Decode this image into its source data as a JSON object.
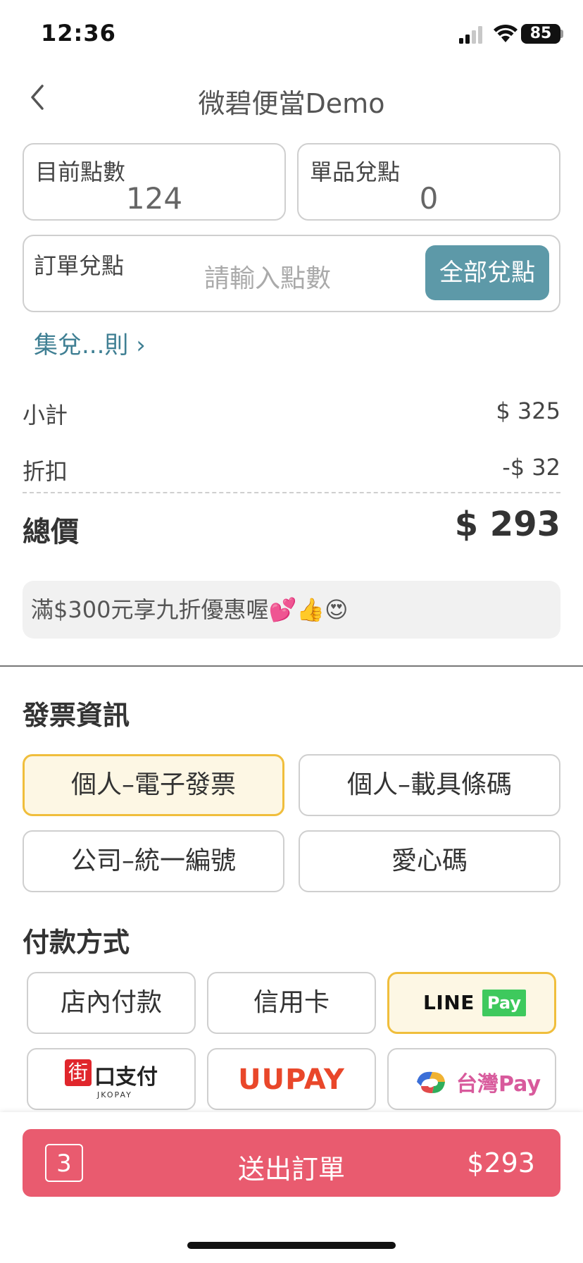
{
  "status_bar": {
    "time": "12:36",
    "battery": "85"
  },
  "nav": {
    "title": "微碧便當Demo"
  },
  "points": {
    "current_label": "目前點數",
    "current_value": "124",
    "item_label": "單品兌點",
    "item_value": "0",
    "order_label": "訂單兌點",
    "order_placeholder": "請輸入點數",
    "redeem_all_label": "全部兌點",
    "rules_link": "集兌...則 ›"
  },
  "summary": {
    "subtotal_label": "小計",
    "subtotal_value": "$ 325",
    "discount_label": "折扣",
    "discount_value": "-$ 32",
    "total_label": "總價",
    "total_value": "$ 293"
  },
  "promo": {
    "text": "滿$300元享九折優惠喔💕👍😍"
  },
  "invoice": {
    "title": "發票資訊",
    "options": [
      "個人–電子發票",
      "個人–載具條碼",
      "公司–統一編號",
      "愛心碼"
    ],
    "selected": "個人–電子發票"
  },
  "payment": {
    "title": "付款方式",
    "options": [
      "店內付款",
      "信用卡",
      "LINE Pay",
      "街口支付",
      "UUPAY",
      "台灣Pay"
    ],
    "selected": "LINE Pay",
    "linepay": {
      "line": "LINE",
      "pay": "Pay"
    },
    "jkopay": {
      "jie": "街",
      "kou": "口支付",
      "sub": "JKOPAY"
    },
    "uupay": {
      "text": "UUPAY"
    },
    "taiwanpay": {
      "text": "台灣Pay"
    }
  },
  "submit": {
    "count": "3",
    "label": "送出訂單",
    "price": "$293"
  },
  "colors": {
    "accent_teal": "#5d99a8",
    "submit_red": "#e95b6f",
    "selected_border": "#f0be3c",
    "selected_bg": "#fdf7e4",
    "linepay_green": "#3ec95d",
    "jkopay_red": "#e0262c",
    "uupay_orange": "#e9472a",
    "taiwanpay_pink": "#d85a9c"
  }
}
